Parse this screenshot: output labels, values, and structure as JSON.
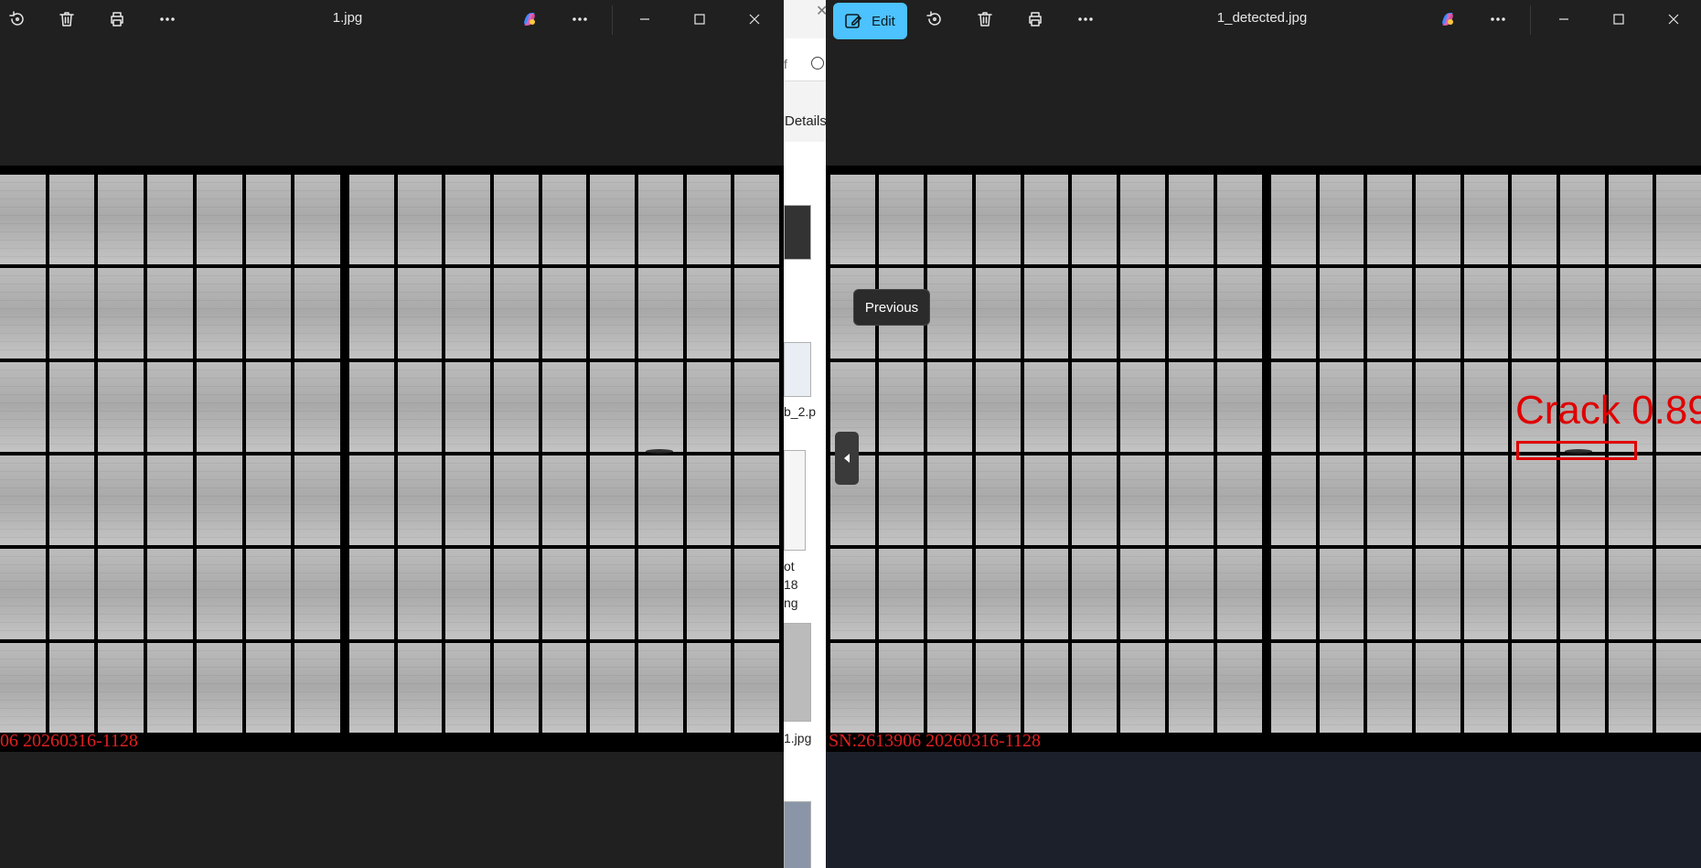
{
  "left_window": {
    "title": "1.jpg",
    "toolbar": [
      "rotate-icon",
      "delete-icon",
      "print-icon",
      "more-icon"
    ],
    "image_caption": "06  20260316-1128"
  },
  "explorer_strip": {
    "search_partial": "f",
    "details_label": "Details",
    "file_label_1": "b_2.p",
    "file_label_2_line1": "ot",
    "file_label_2_line2": "18",
    "file_label_2_line3": "ng",
    "file_label_3": "1.jpg"
  },
  "right_window": {
    "title": "1_detected.jpg",
    "edit_label": "Edit",
    "tooltip": "Previous",
    "image_caption": "SN:2613906  20260316-1128",
    "detection": {
      "label": "Crack 0.89"
    }
  },
  "colors": {
    "accent": "#4cc2ff",
    "detection": "#e00000",
    "background": "#202020"
  }
}
